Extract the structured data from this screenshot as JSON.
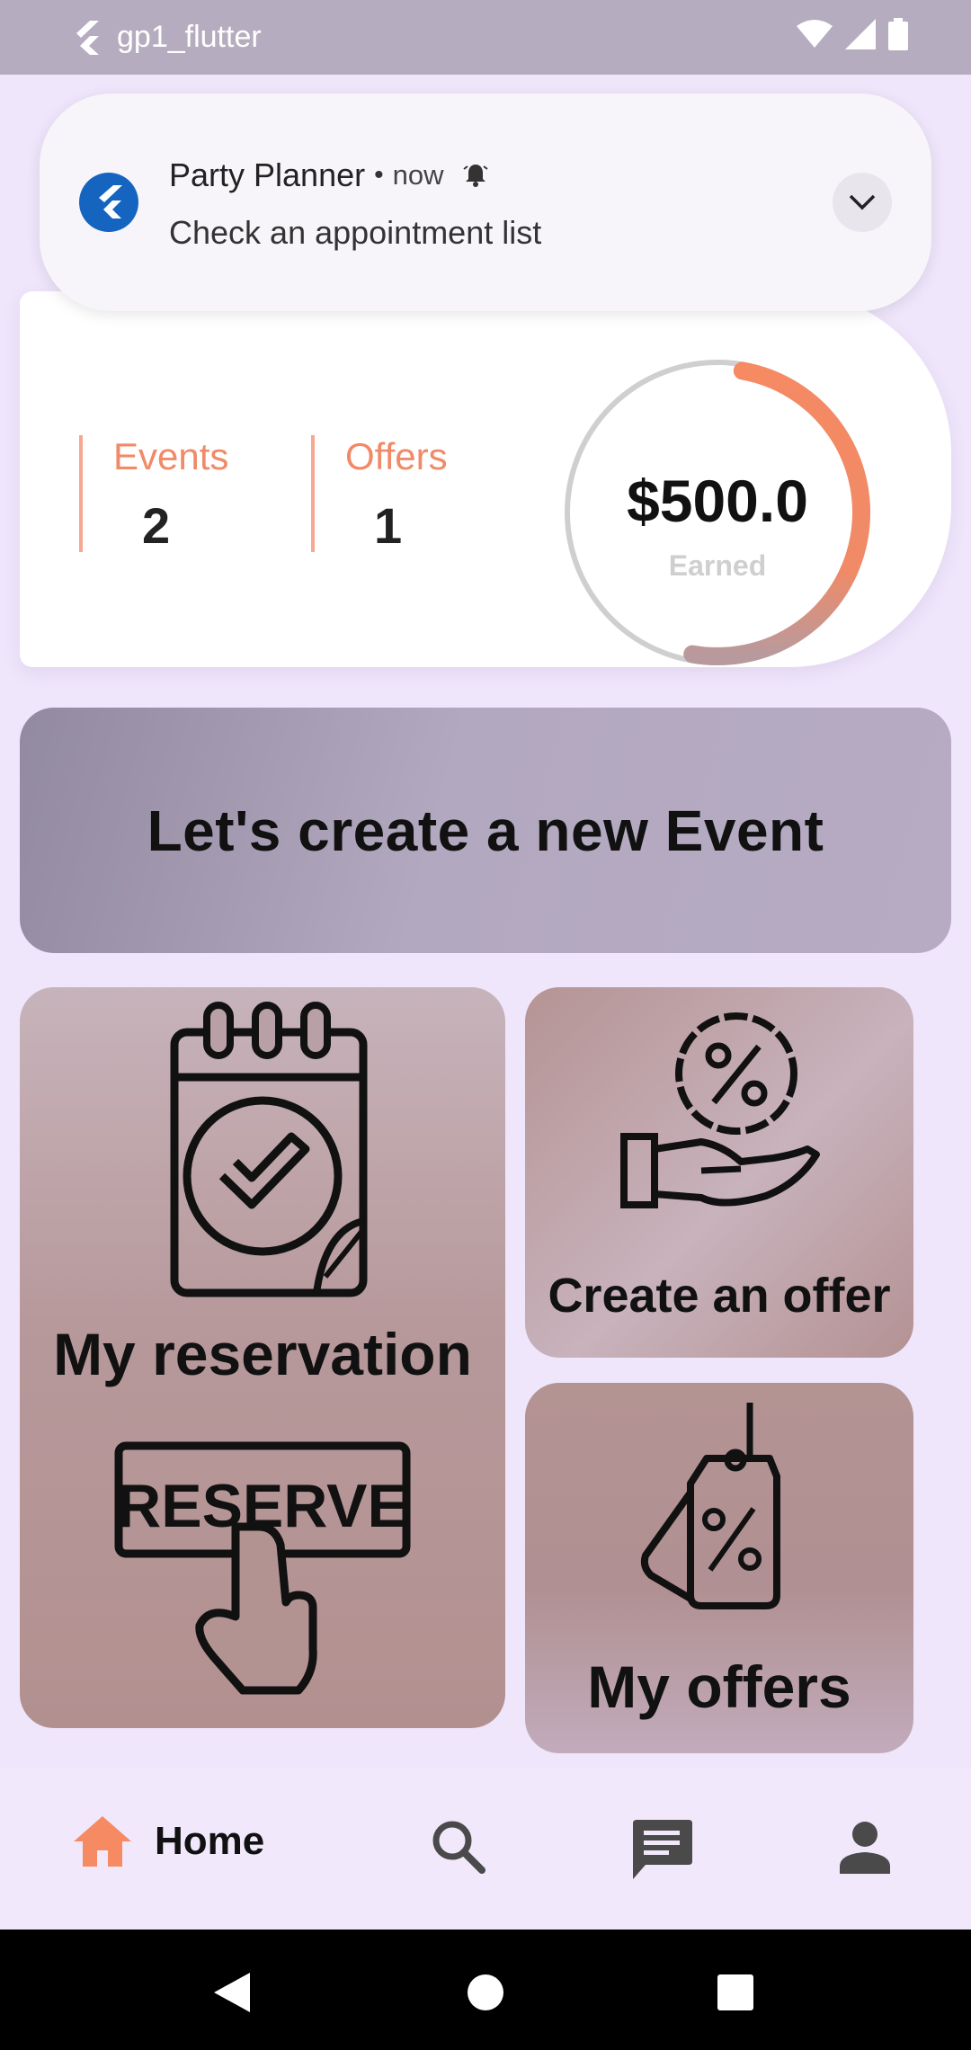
{
  "status_bar": {
    "app_label": "gp1_flutter"
  },
  "notification": {
    "app_name": "Party Planner",
    "separator": "•",
    "time": "now",
    "message": "Check an appointment list"
  },
  "stats": {
    "events_label": "Events",
    "events_value": "2",
    "offers_label": "Offers",
    "offers_value": "1",
    "earned_amount": "$500.0",
    "earned_label": "Earned",
    "earned_progress_percent": 50
  },
  "banner": {
    "text": "Let's create a new Event"
  },
  "tiles": {
    "reservation_label": "My reservation",
    "reserve_sign_text": "RESERVE",
    "create_offer_label": "Create an offer",
    "my_offers_label": "My offers"
  },
  "bottom_nav": {
    "home_label": "Home"
  },
  "colors": {
    "accent": "#f58a63",
    "status_bar": "#b5adbf",
    "background": "#efe6fb",
    "flutter_blue": "#1565c0"
  }
}
